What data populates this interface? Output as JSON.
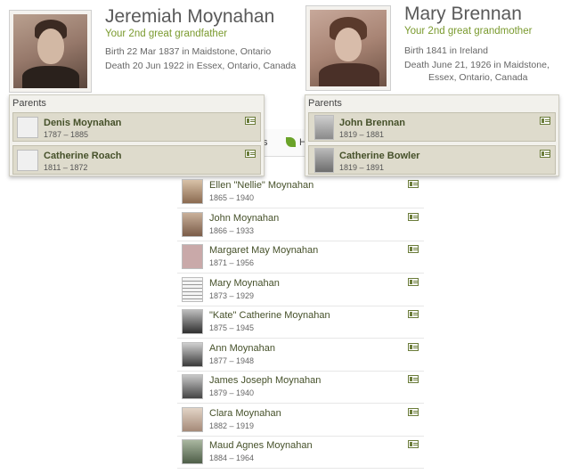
{
  "persons": [
    {
      "name": "Jeremiah Moynahan",
      "relation": "Your 2nd great grandfather",
      "birth": "Birth 22 Mar 1837 in Maidstone, Ontario",
      "death": "Death 20 Jun 1922 in Essex, Ontario, Canada",
      "parents_title": "Parents",
      "parents": [
        {
          "name": "Denis Moynahan",
          "dates": "1787 – 1885"
        },
        {
          "name": "Catherine Roach",
          "dates": "1811 – 1872"
        }
      ]
    },
    {
      "name": "Mary Brennan",
      "relation": "Your 2nd great grandmother",
      "birth": "Birth 1841 in Ireland",
      "death_line1": "Death June 21, 1926 in Maidstone,",
      "death_line2": "Essex, Ontario, Canada",
      "parents_title": "Parents",
      "parents": [
        {
          "name": "John Brennan",
          "dates": "1819 – 1881"
        },
        {
          "name": "Catherine Bowler",
          "dates": "1819 – 1891"
        }
      ]
    }
  ],
  "tabs": {
    "partial_a": "ts",
    "partial_b": "H"
  },
  "children": [
    {
      "name": "Ellen \"Nellie\" Moynahan",
      "dates": "1865 – 1940"
    },
    {
      "name": "John Moynahan",
      "dates": "1866 – 1933"
    },
    {
      "name": "Margaret May Moynahan",
      "dates": "1871 – 1956"
    },
    {
      "name": "Mary Moynahan",
      "dates": "1873 – 1929"
    },
    {
      "name": "\"Kate\" Catherine Moynahan",
      "dates": "1875 – 1945"
    },
    {
      "name": "Ann Moynahan",
      "dates": "1877 – 1948"
    },
    {
      "name": "James Joseph Moynahan",
      "dates": "1879 – 1940"
    },
    {
      "name": "Clara Moynahan",
      "dates": "1882 – 1919"
    },
    {
      "name": "Maud Agnes Moynahan",
      "dates": "1884 – 1964"
    }
  ],
  "colors": {
    "accent_green": "#7a9a2e",
    "name_green": "#46512a",
    "panel_bg": "#f2f1ec",
    "row_bg": "#dedbcc"
  },
  "icons": {
    "profile_card": "profile-card-icon",
    "hints_leaf": "leaf-icon"
  }
}
